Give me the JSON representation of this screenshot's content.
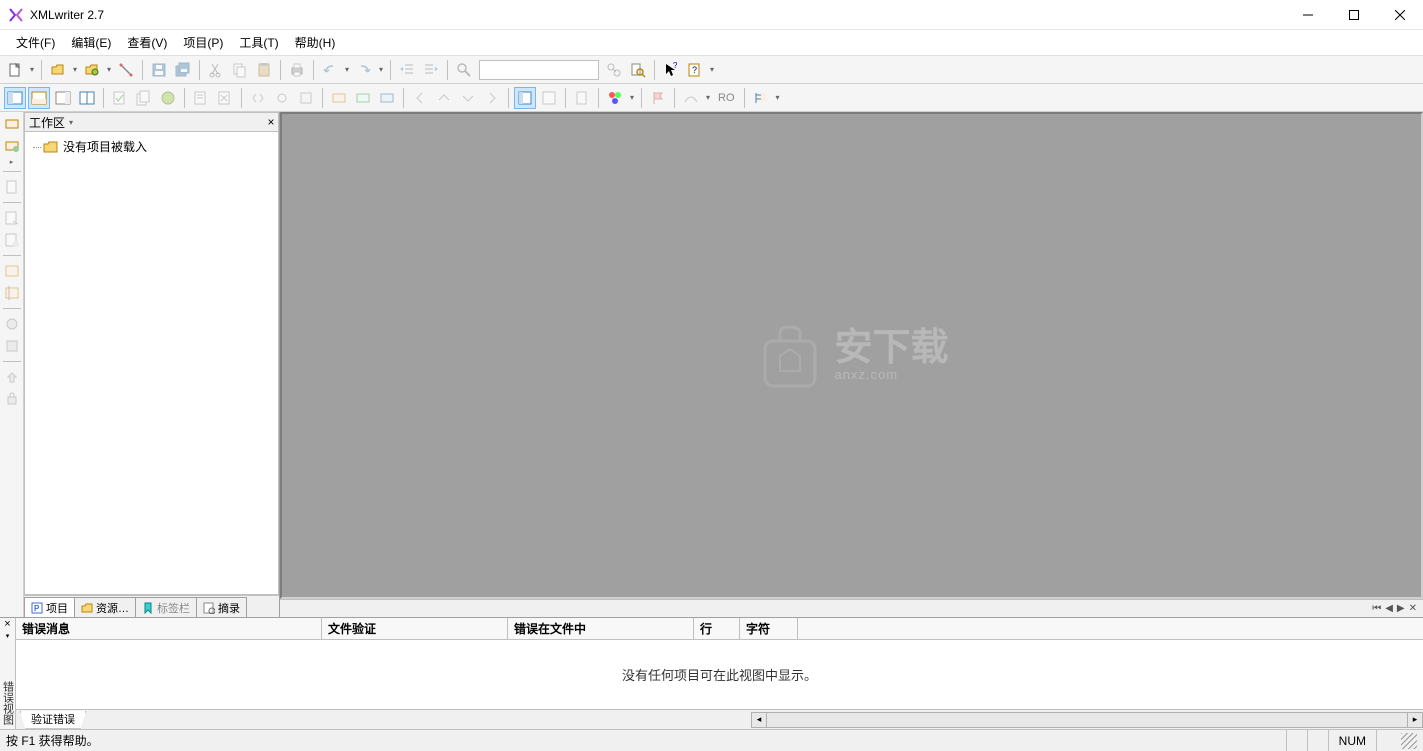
{
  "title": "XMLwriter 2.7",
  "menu": {
    "file": "文件(F)",
    "edit": "编辑(E)",
    "view": "查看(V)",
    "project": "项目(P)",
    "tools": "工具(T)",
    "help": "帮助(H)"
  },
  "toolbar2": {
    "ro": "RO"
  },
  "workspace": {
    "title": "工作区",
    "tree_root": "没有项目被载入",
    "tabs": {
      "project": "项目",
      "resource": "资源…",
      "bookmark": "标签栏",
      "summary": "摘录"
    }
  },
  "watermark": {
    "main": "安下载",
    "sub": "anxz.com"
  },
  "bottom": {
    "side_label": "错误视图",
    "headers": {
      "error_msg": "错误消息",
      "file_verify": "文件验证",
      "error_in_file": "错误在文件中",
      "line": "行",
      "char": "字符"
    },
    "empty_msg": "没有任何项目可在此视图中显示。",
    "tab": "验证错误"
  },
  "status": {
    "help": "按 F1 获得帮助。",
    "num": "NUM"
  }
}
